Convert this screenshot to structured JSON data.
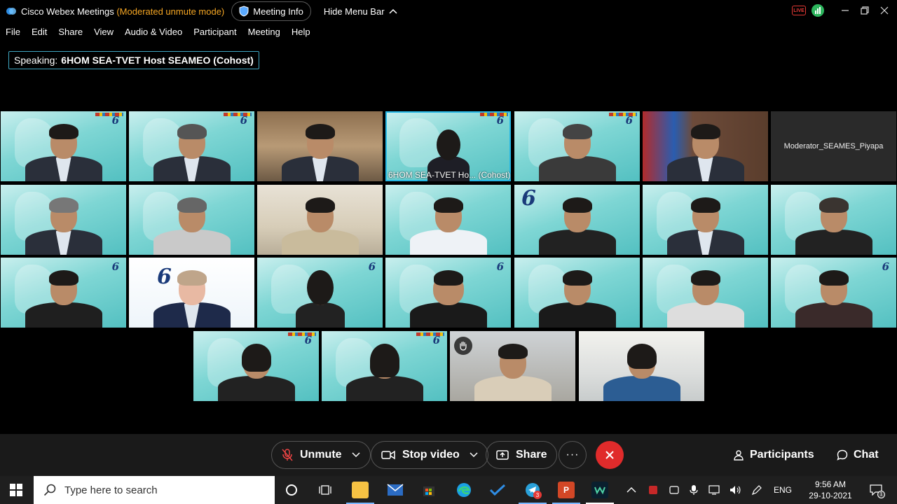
{
  "window": {
    "app_name": "Cisco Webex Meetings",
    "mode": "(Moderated unmute mode)",
    "meeting_info_label": "Meeting Info",
    "hide_menu_label": "Hide Menu Bar",
    "live_badge": "LIVE"
  },
  "menu": [
    "File",
    "Edit",
    "Share",
    "View",
    "Audio & Video",
    "Participant",
    "Meeting",
    "Help"
  ],
  "speaking": {
    "prefix": "Speaking:",
    "name": "6HOM SEA-TVET Host SEAMEO (Cohost)"
  },
  "tiles": {
    "active_label": "6HOM SEA-TVET Ho... (Cohost)",
    "moderator_name": "Moderator_SEAMES_Piyapa",
    "sign_text": "6"
  },
  "controls": {
    "unmute_label": "Unmute",
    "stop_video_label": "Stop video",
    "share_label": "Share",
    "more_label": "···",
    "participants_label": "Participants",
    "chat_label": "Chat"
  },
  "taskbar": {
    "search_placeholder": "Type here to search",
    "language": "ENG",
    "time": "9:56 AM",
    "date": "29-10-2021",
    "telegram_badge": "3",
    "notification_count": "1"
  },
  "colors": {
    "mode_text": "#f5a623",
    "active_outline": "#25b8e6",
    "end_call": "#e02b2b",
    "speaking_border": "#3fa7c2"
  }
}
